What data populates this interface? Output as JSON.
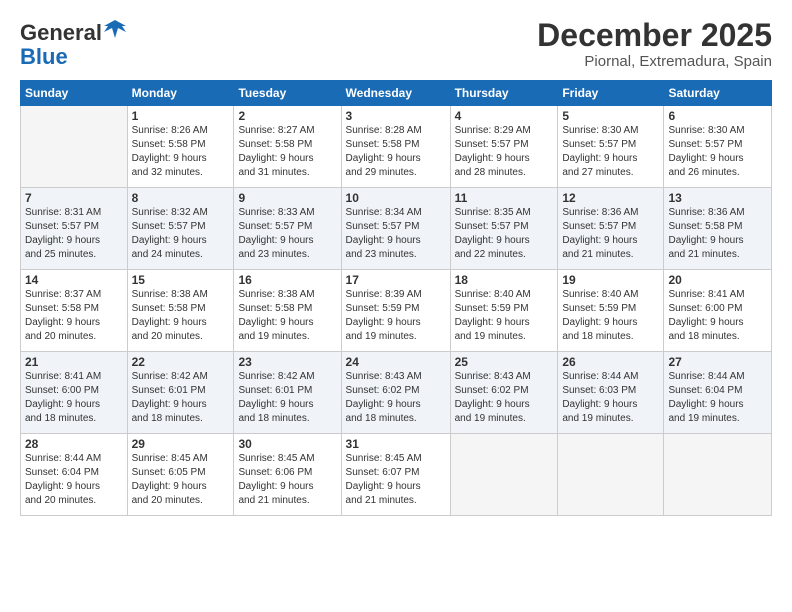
{
  "header": {
    "logo_line1": "General",
    "logo_line2": "Blue",
    "month": "December 2025",
    "location": "Piornal, Extremadura, Spain"
  },
  "days_of_week": [
    "Sunday",
    "Monday",
    "Tuesday",
    "Wednesday",
    "Thursday",
    "Friday",
    "Saturday"
  ],
  "weeks": [
    [
      {
        "num": "",
        "info": ""
      },
      {
        "num": "1",
        "info": "Sunrise: 8:26 AM\nSunset: 5:58 PM\nDaylight: 9 hours\nand 32 minutes."
      },
      {
        "num": "2",
        "info": "Sunrise: 8:27 AM\nSunset: 5:58 PM\nDaylight: 9 hours\nand 31 minutes."
      },
      {
        "num": "3",
        "info": "Sunrise: 8:28 AM\nSunset: 5:58 PM\nDaylight: 9 hours\nand 29 minutes."
      },
      {
        "num": "4",
        "info": "Sunrise: 8:29 AM\nSunset: 5:57 PM\nDaylight: 9 hours\nand 28 minutes."
      },
      {
        "num": "5",
        "info": "Sunrise: 8:30 AM\nSunset: 5:57 PM\nDaylight: 9 hours\nand 27 minutes."
      },
      {
        "num": "6",
        "info": "Sunrise: 8:30 AM\nSunset: 5:57 PM\nDaylight: 9 hours\nand 26 minutes."
      }
    ],
    [
      {
        "num": "7",
        "info": "Sunrise: 8:31 AM\nSunset: 5:57 PM\nDaylight: 9 hours\nand 25 minutes."
      },
      {
        "num": "8",
        "info": "Sunrise: 8:32 AM\nSunset: 5:57 PM\nDaylight: 9 hours\nand 24 minutes."
      },
      {
        "num": "9",
        "info": "Sunrise: 8:33 AM\nSunset: 5:57 PM\nDaylight: 9 hours\nand 23 minutes."
      },
      {
        "num": "10",
        "info": "Sunrise: 8:34 AM\nSunset: 5:57 PM\nDaylight: 9 hours\nand 23 minutes."
      },
      {
        "num": "11",
        "info": "Sunrise: 8:35 AM\nSunset: 5:57 PM\nDaylight: 9 hours\nand 22 minutes."
      },
      {
        "num": "12",
        "info": "Sunrise: 8:36 AM\nSunset: 5:57 PM\nDaylight: 9 hours\nand 21 minutes."
      },
      {
        "num": "13",
        "info": "Sunrise: 8:36 AM\nSunset: 5:58 PM\nDaylight: 9 hours\nand 21 minutes."
      }
    ],
    [
      {
        "num": "14",
        "info": "Sunrise: 8:37 AM\nSunset: 5:58 PM\nDaylight: 9 hours\nand 20 minutes."
      },
      {
        "num": "15",
        "info": "Sunrise: 8:38 AM\nSunset: 5:58 PM\nDaylight: 9 hours\nand 20 minutes."
      },
      {
        "num": "16",
        "info": "Sunrise: 8:38 AM\nSunset: 5:58 PM\nDaylight: 9 hours\nand 19 minutes."
      },
      {
        "num": "17",
        "info": "Sunrise: 8:39 AM\nSunset: 5:59 PM\nDaylight: 9 hours\nand 19 minutes."
      },
      {
        "num": "18",
        "info": "Sunrise: 8:40 AM\nSunset: 5:59 PM\nDaylight: 9 hours\nand 19 minutes."
      },
      {
        "num": "19",
        "info": "Sunrise: 8:40 AM\nSunset: 5:59 PM\nDaylight: 9 hours\nand 18 minutes."
      },
      {
        "num": "20",
        "info": "Sunrise: 8:41 AM\nSunset: 6:00 PM\nDaylight: 9 hours\nand 18 minutes."
      }
    ],
    [
      {
        "num": "21",
        "info": "Sunrise: 8:41 AM\nSunset: 6:00 PM\nDaylight: 9 hours\nand 18 minutes."
      },
      {
        "num": "22",
        "info": "Sunrise: 8:42 AM\nSunset: 6:01 PM\nDaylight: 9 hours\nand 18 minutes."
      },
      {
        "num": "23",
        "info": "Sunrise: 8:42 AM\nSunset: 6:01 PM\nDaylight: 9 hours\nand 18 minutes."
      },
      {
        "num": "24",
        "info": "Sunrise: 8:43 AM\nSunset: 6:02 PM\nDaylight: 9 hours\nand 18 minutes."
      },
      {
        "num": "25",
        "info": "Sunrise: 8:43 AM\nSunset: 6:02 PM\nDaylight: 9 hours\nand 19 minutes."
      },
      {
        "num": "26",
        "info": "Sunrise: 8:44 AM\nSunset: 6:03 PM\nDaylight: 9 hours\nand 19 minutes."
      },
      {
        "num": "27",
        "info": "Sunrise: 8:44 AM\nSunset: 6:04 PM\nDaylight: 9 hours\nand 19 minutes."
      }
    ],
    [
      {
        "num": "28",
        "info": "Sunrise: 8:44 AM\nSunset: 6:04 PM\nDaylight: 9 hours\nand 20 minutes."
      },
      {
        "num": "29",
        "info": "Sunrise: 8:45 AM\nSunset: 6:05 PM\nDaylight: 9 hours\nand 20 minutes."
      },
      {
        "num": "30",
        "info": "Sunrise: 8:45 AM\nSunset: 6:06 PM\nDaylight: 9 hours\nand 21 minutes."
      },
      {
        "num": "31",
        "info": "Sunrise: 8:45 AM\nSunset: 6:07 PM\nDaylight: 9 hours\nand 21 minutes."
      },
      {
        "num": "",
        "info": ""
      },
      {
        "num": "",
        "info": ""
      },
      {
        "num": "",
        "info": ""
      }
    ]
  ]
}
